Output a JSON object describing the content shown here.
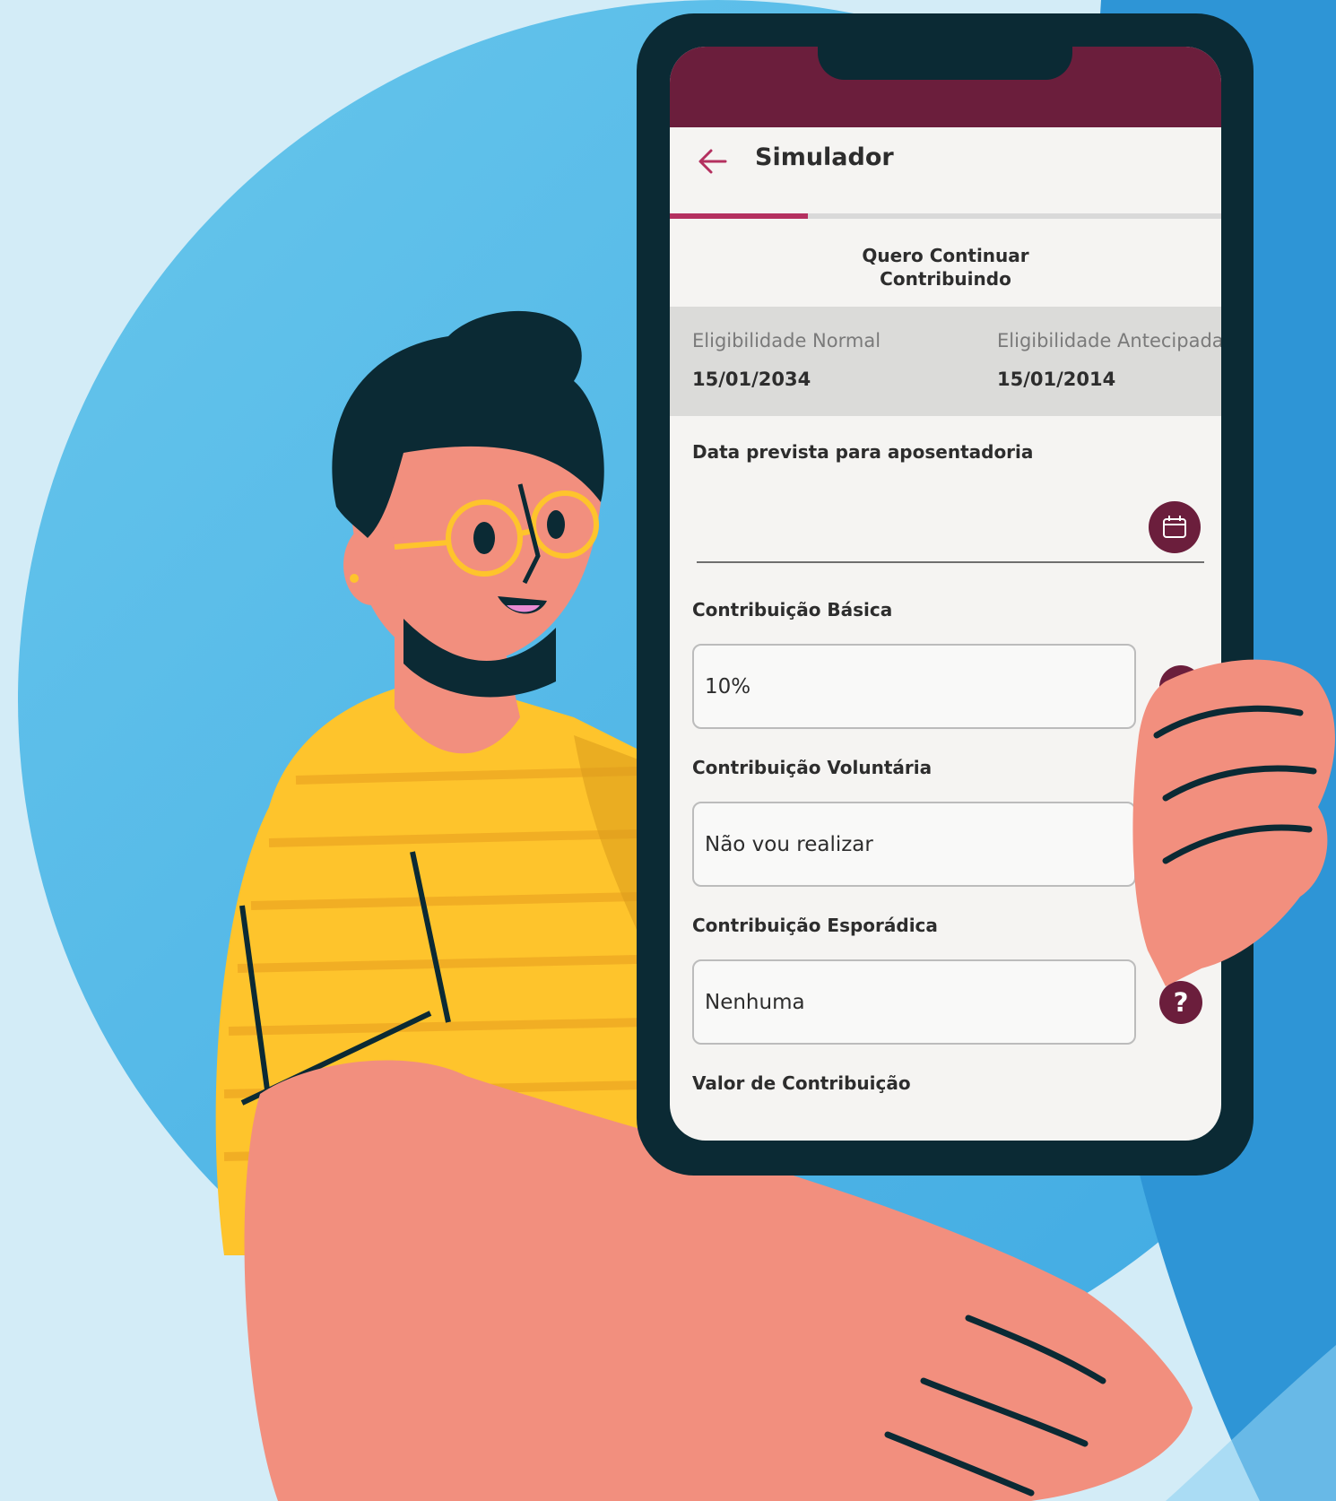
{
  "theme": {
    "primary": "#6b1e3c",
    "accent": "#b4305f",
    "phone_frame": "#0b2a34",
    "sky_light": "#d3ecf7",
    "sky_mid": "#5bbde9",
    "sky_dark": "#2e95d6"
  },
  "app": {
    "title": "Simulador",
    "back_icon": "arrow-left-icon",
    "progress_fraction": 0.25,
    "subtitle_line1": "Quero Continuar",
    "subtitle_line2": "Contribuindo"
  },
  "eligibility": {
    "normal_label": "Eligibilidade Normal",
    "normal_date": "15/01/2034",
    "early_label": "Eligibilidade Antecipada",
    "early_date": "15/01/2014"
  },
  "form": {
    "retirement_date_label": "Data prevista para aposentadoria",
    "retirement_date_value": "",
    "calendar_icon": "calendar-icon",
    "basic_label": "Contribuição Básica",
    "basic_value": "10%",
    "voluntary_label": "Contribuição Voluntária",
    "voluntary_value": "Não vou realizar",
    "sporadic_label": "Contribuição Esporádica",
    "sporadic_value": "Nenhuma",
    "help_icon": "question-mark-icon",
    "help_glyph": "?",
    "amount_label": "Valor de Contribuição"
  }
}
